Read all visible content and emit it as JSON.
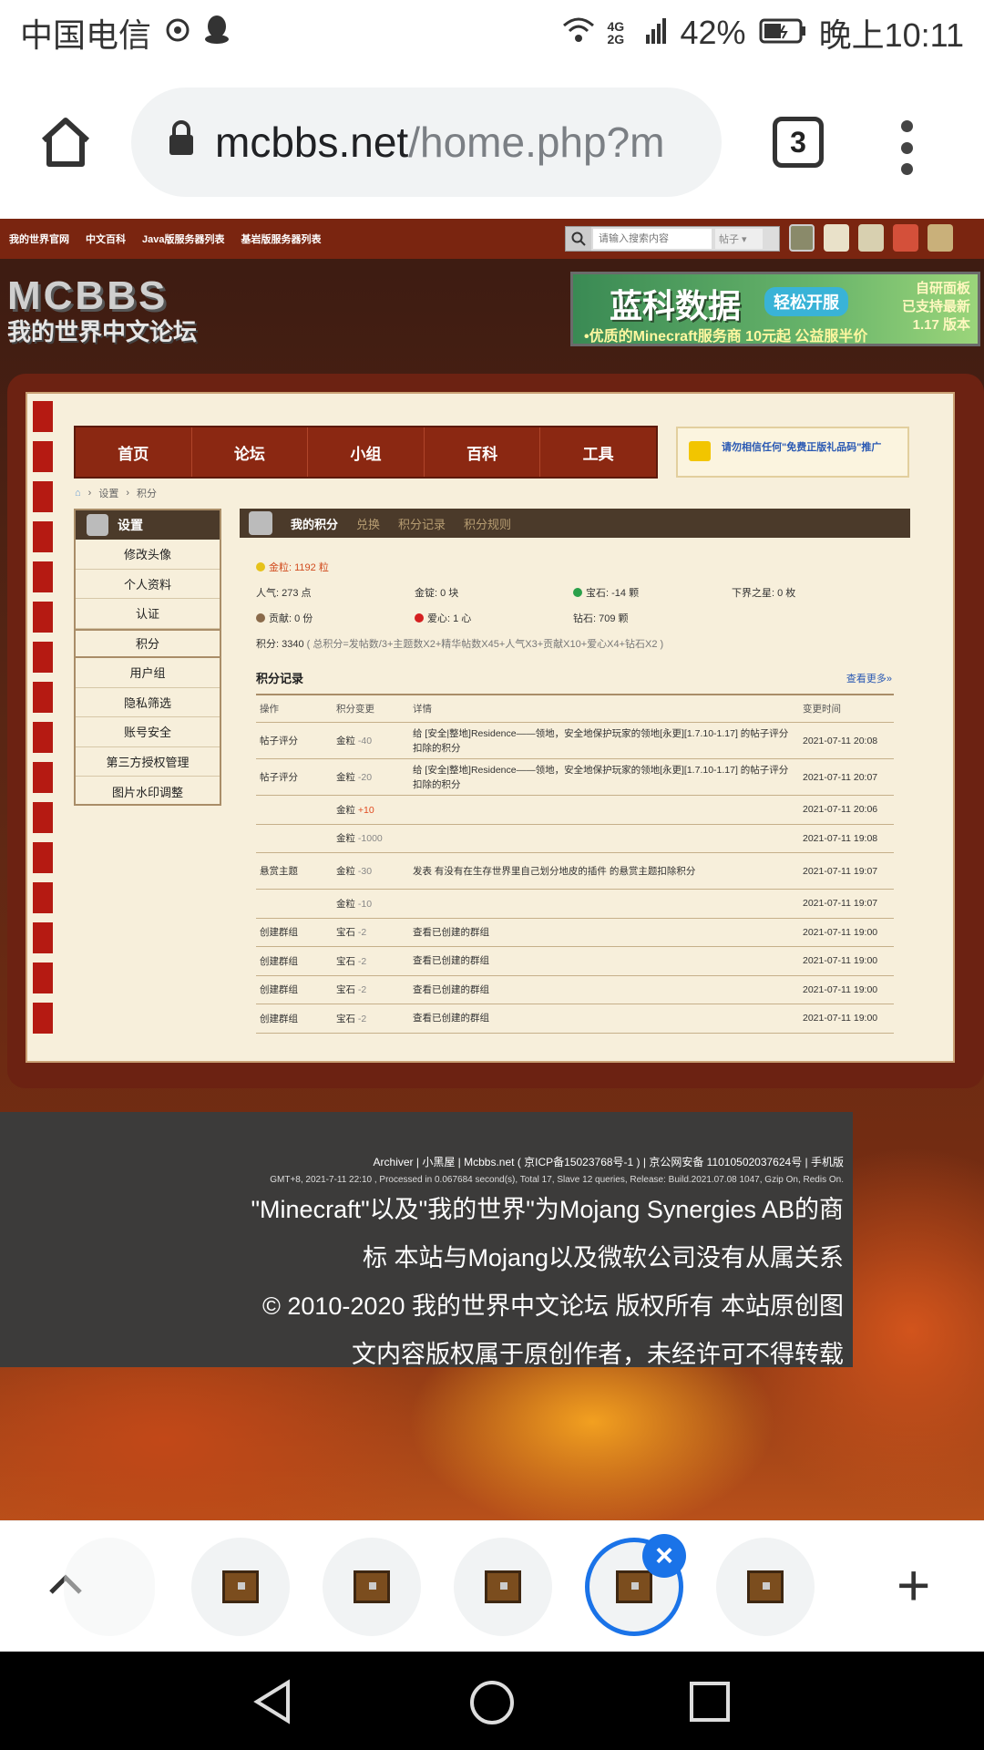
{
  "status": {
    "carrier": "中国电信",
    "network": "4G 2G",
    "battery": "42%",
    "time": "晚上10:11"
  },
  "browser": {
    "url_host": "mcbbs.net",
    "url_path": "/home.php?m",
    "tab_count": "3"
  },
  "topnav": [
    "我的世界官网",
    "中文百科",
    "Java版服务器列表",
    "基岩版服务器列表"
  ],
  "search": {
    "placeholder": "请输入搜索内容",
    "type": "帖子"
  },
  "logo": {
    "big": "MCBBS",
    "small": "我的世界中文论坛"
  },
  "banner": {
    "title": "蓝科数据",
    "badge": "轻松开服",
    "line": "•优质的Minecraft服务商 10元起 公益服半价",
    "side1": "自研面板",
    "side2": "已支持最新",
    "side3": "1.17 版本"
  },
  "mainnav": [
    "首页",
    "论坛",
    "小组",
    "百科",
    "工具"
  ],
  "notice": "请勿相信任何\"免费正版礼品码\"推广",
  "breadcrumb": [
    "设置",
    "积分"
  ],
  "sidebar": {
    "title": "设置",
    "items": [
      "修改头像",
      "个人资料",
      "认证",
      "积分",
      "用户组",
      "隐私筛选",
      "账号安全",
      "第三方授权管理",
      "图片水印调整"
    ]
  },
  "tabs": {
    "current": "我的积分",
    "others": [
      "兑换",
      "积分记录",
      "积分规则"
    ]
  },
  "credits": {
    "gold": "金粒: 1192 粒",
    "row1": [
      "人气: 273 点",
      "金锭: 0 块",
      "宝石: -14 颗",
      "下界之星: 0 枚"
    ],
    "row2": [
      "贡献: 0 份",
      "爱心: 1 心",
      "钻石: 709 颗"
    ],
    "total_label": "积分: 3340",
    "total_formula": "( 总积分=发帖数/3+主题数X2+精华帖数X45+人气X3+贡献X10+爱心X4+钻石X2 )"
  },
  "records": {
    "title": "积分记录",
    "more": "查看更多»",
    "headers": [
      "操作",
      "积分变更",
      "详情",
      "变更时间"
    ],
    "rows": [
      {
        "op": "帖子评分",
        "unit": "金粒",
        "delta": "-40",
        "detail": "给 [安全|整地]Residence——领地，安全地保护玩家的领地[永更][1.7.10-1.17] 的帖子评分扣除的积分",
        "time": "2021-07-11 20:08"
      },
      {
        "op": "帖子评分",
        "unit": "金粒",
        "delta": "-20",
        "detail": "给 [安全|整地]Residence——领地，安全地保护玩家的领地[永更][1.7.10-1.17] 的帖子评分扣除的积分",
        "time": "2021-07-11 20:07"
      },
      {
        "op": "",
        "unit": "金粒",
        "delta": "+10",
        "detail": "",
        "time": "2021-07-11 20:06"
      },
      {
        "op": "",
        "unit": "金粒",
        "delta": "-1000",
        "detail": "",
        "time": "2021-07-11 19:08"
      },
      {
        "op": "悬赏主题",
        "unit": "金粒",
        "delta": "-30",
        "detail": "发表 有没有在生存世界里自己划分地皮的插件 的悬赏主题扣除积分",
        "time": "2021-07-11 19:07"
      },
      {
        "op": "",
        "unit": "金粒",
        "delta": "-10",
        "detail": "",
        "time": "2021-07-11 19:07"
      },
      {
        "op": "创建群组",
        "unit": "宝石",
        "delta": "-2",
        "detail": "查看已创建的群组",
        "time": "2021-07-11 19:00"
      },
      {
        "op": "创建群组",
        "unit": "宝石",
        "delta": "-2",
        "detail": "查看已创建的群组",
        "time": "2021-07-11 19:00"
      },
      {
        "op": "创建群组",
        "unit": "宝石",
        "delta": "-2",
        "detail": "查看已创建的群组",
        "time": "2021-07-11 19:00"
      },
      {
        "op": "创建群组",
        "unit": "宝石",
        "delta": "-2",
        "detail": "查看已创建的群组",
        "time": "2021-07-11 19:00"
      }
    ]
  },
  "footer": {
    "links": "Archiver | 小黑屋 | Mcbbs.net ( 京ICP备15023768号-1 ) | 京公网安备 11010502037624号 | 手机版",
    "stats": "GMT+8, 2021-7-11 22:10 , Processed in 0.067684 second(s), Total 17, Slave 12 queries, Release: Build.2021.07.08 1047, Gzip On, Redis On.",
    "lines": [
      "\"Minecraft\"以及\"我的世界\"为Mojang Synergies AB的商",
      "标 本站与Mojang以及微软公司没有从属关系",
      "© 2010-2020 我的世界中文论坛 版权所有 本站原创图",
      "文内容版权属于原创作者，未经许可不得转载"
    ]
  },
  "colors": {
    "accent": "#1a73e8",
    "nav_red": "#8b2812",
    "paper": "#f7efdb"
  }
}
